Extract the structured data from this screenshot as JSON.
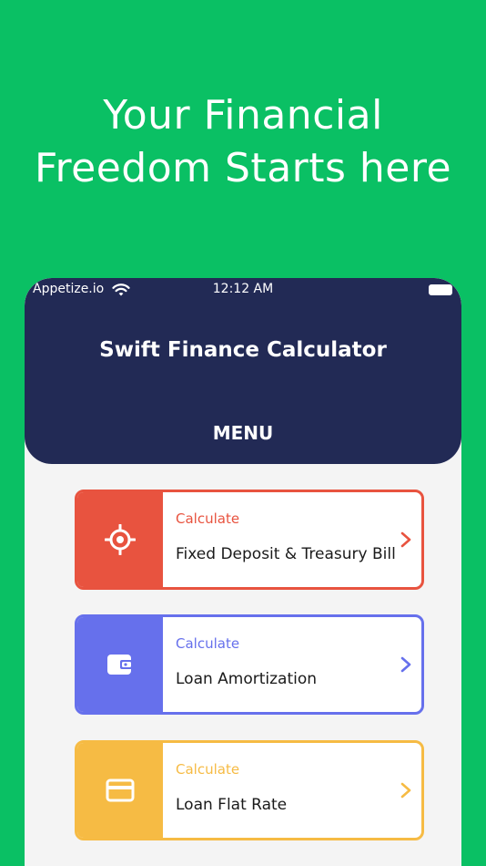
{
  "headline": {
    "line1": "Your Financial",
    "line2": "Freedom Starts here"
  },
  "statusbar": {
    "carrier": "Appetize.io",
    "time": "12:12 AM"
  },
  "app": {
    "title": "Swift Finance Calculator",
    "menu_label": "MENU"
  },
  "cards": [
    {
      "sub": "Calculate",
      "title": "Fixed Deposit & Treasury Bill",
      "color": "#e8533f",
      "icon": "target-icon"
    },
    {
      "sub": "Calculate",
      "title": "Loan Amortization",
      "color": "#6670ec",
      "icon": "wallet-icon"
    },
    {
      "sub": "Calculate",
      "title": "Loan Flat Rate",
      "color": "#f6bb44",
      "icon": "credit-card-icon"
    }
  ],
  "colors": {
    "background": "#0ac064",
    "header": "#222a55"
  }
}
